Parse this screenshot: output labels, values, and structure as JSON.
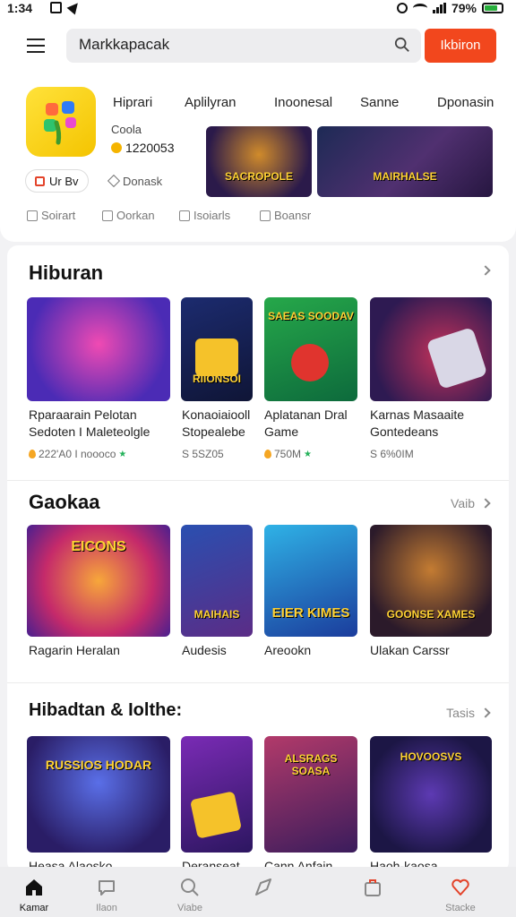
{
  "status_bar": {
    "time": "1:34",
    "battery": "79%",
    "battery_level": 0.79
  },
  "header": {
    "search_value": "Markkapacak",
    "search_button": "Ikbiron"
  },
  "featured_app": {
    "name": "Coola",
    "rating_count": "1220053",
    "tabs": [
      "Hiprari",
      "Aplilyran",
      "Inoonesal",
      "Sanne",
      "Dponasin"
    ],
    "buttons": [
      "Ur Bv",
      "Donask"
    ],
    "banners": [
      "SACROPOLE",
      "MAIRHALSE"
    ]
  },
  "quick_links": [
    "Soirart",
    "Oorkan",
    "Isoiarls",
    "Boansr"
  ],
  "sections": [
    {
      "title": "Hiburan",
      "more": "",
      "items": [
        {
          "title": "Rparaarain Pelotan Sedoten I Maleteolgle",
          "meta": "222'A0 I noooco",
          "meta_icon": "flame",
          "star": true
        },
        {
          "title": "Konaoiaiooll Stopealebe",
          "meta": "S 5SZ05",
          "meta_icon": "none",
          "star": false
        },
        {
          "title": "Aplatanan Dral Game",
          "meta": "750M",
          "meta_icon": "flame",
          "star": true
        },
        {
          "title": "Karnas Masaaite Gontedeans",
          "meta": "S 6%0IM",
          "meta_icon": "none",
          "star": false
        }
      ],
      "thumb_labels": [
        "",
        "RIIONSOI",
        "SAEAS SOODAV",
        ""
      ]
    },
    {
      "title": "Gaokaa",
      "more": "Vaib",
      "items": [
        {
          "title": "Ragarin Heralan"
        },
        {
          "title": "Audesis"
        },
        {
          "title": "Areookn"
        },
        {
          "title": "Ulakan Carssr"
        }
      ],
      "thumb_labels": [
        "EICONS",
        "MAIHAIS",
        "EIER KIMES",
        "GOONSE XAMES"
      ]
    },
    {
      "title": "Hibadtan & Iolthe:",
      "more": "Tasis",
      "items": [
        {
          "title": "Heasa Alaosko"
        },
        {
          "title": "Deranseat"
        },
        {
          "title": "Cann Anfain"
        },
        {
          "title": "Haoh-kaosa"
        }
      ],
      "thumb_labels": [
        "RUSSIOS HODAR",
        "",
        "ALSRAGS SOASA",
        "HOVOOSVS"
      ]
    }
  ],
  "bottom_nav": [
    {
      "label": "Kamar",
      "icon": "home-icon",
      "active": true
    },
    {
      "label": "Ilaon",
      "icon": "chat-icon",
      "active": false
    },
    {
      "label": "Viabe",
      "icon": "search-icon",
      "active": false
    },
    {
      "label": "",
      "icon": "send-icon",
      "active": false
    },
    {
      "label": "",
      "icon": "bag-icon",
      "active": false
    },
    {
      "label": "Stacke",
      "icon": "heart-icon",
      "active": false
    }
  ],
  "colors": {
    "accent": "#f2471d",
    "rating_star": "#25b25b"
  }
}
